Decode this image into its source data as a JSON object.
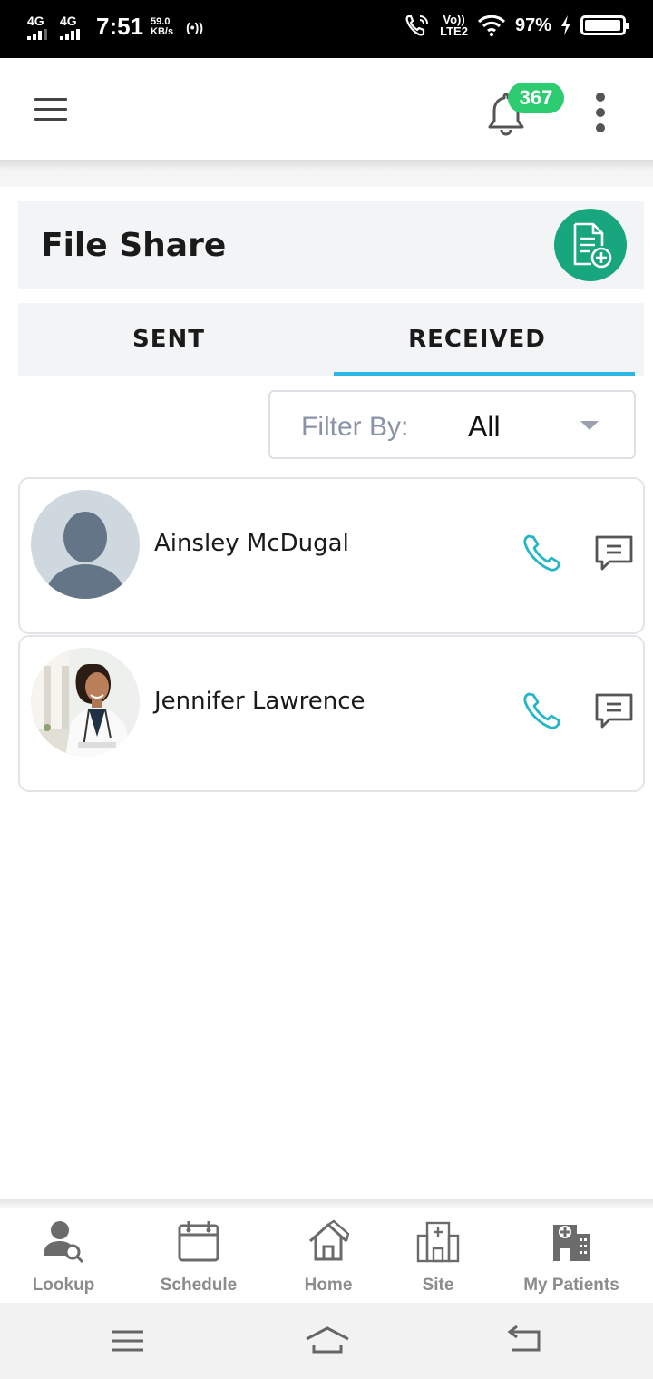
{
  "status_bar": {
    "network1": "4G",
    "network2": "4G",
    "time": "7:51",
    "speed_value": "59.0",
    "speed_unit": "KB/s",
    "hotspot": "(•))",
    "volte_top": "Vo))",
    "volte_bottom": "LTE2",
    "battery_percent": "97%",
    "battery_level": 0.97
  },
  "header": {
    "notification_count": "367",
    "colors": {
      "badge": "#2ecc71",
      "accent": "#17a67e",
      "tab_underline": "#2bb6e6",
      "phone_icon": "#25b5c9"
    }
  },
  "page": {
    "title": "File Share"
  },
  "tabs": [
    {
      "label": "SENT",
      "active": false
    },
    {
      "label": "RECEIVED",
      "active": true
    }
  ],
  "filter": {
    "label": "Filter By:",
    "value": "All"
  },
  "contacts": [
    {
      "name": "Ainsley McDugal",
      "avatar": "default-avatar-icon"
    },
    {
      "name": "Jennifer Lawrence",
      "avatar": "doctor-photo"
    }
  ],
  "bottom_nav": [
    {
      "label": "Lookup",
      "icon": "user-search-icon"
    },
    {
      "label": "Schedule",
      "icon": "calendar-icon"
    },
    {
      "label": "Home",
      "icon": "home-icon"
    },
    {
      "label": "Site",
      "icon": "hospital-building-icon"
    },
    {
      "label": "My Patients",
      "icon": "hospital-icon"
    }
  ]
}
